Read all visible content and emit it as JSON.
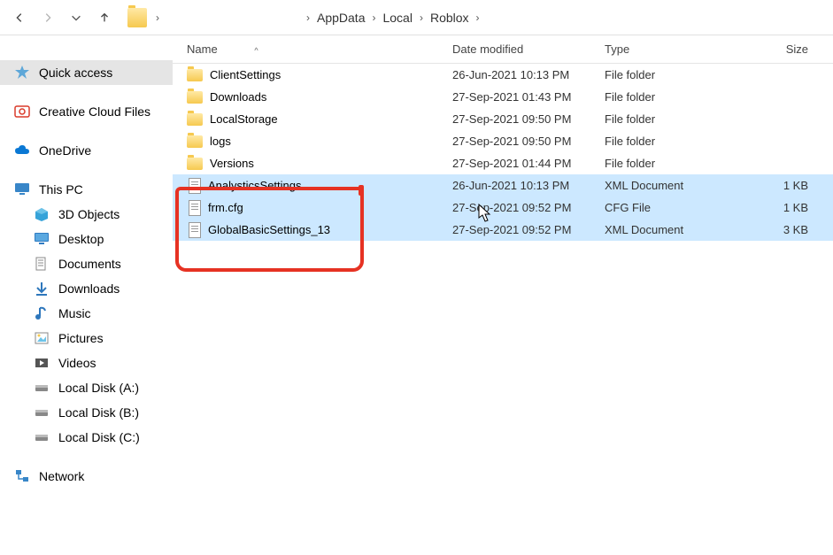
{
  "breadcrumbs": [
    "AppData",
    "Local",
    "Roblox"
  ],
  "sidebar": {
    "quick_access": "Quick access",
    "creative_cloud": "Creative Cloud Files",
    "onedrive": "OneDrive",
    "this_pc": "This PC",
    "objects3d": "3D Objects",
    "desktop": "Desktop",
    "documents": "Documents",
    "downloads": "Downloads",
    "music": "Music",
    "pictures": "Pictures",
    "videos": "Videos",
    "diskA": "Local Disk (A:)",
    "diskB": "Local Disk (B:)",
    "diskC": "Local Disk (C:)",
    "network": "Network"
  },
  "columns": {
    "name": "Name",
    "date": "Date modified",
    "type": "Type",
    "size": "Size"
  },
  "files": [
    {
      "name": "ClientSettings",
      "date": "26-Jun-2021 10:13 PM",
      "type": "File folder",
      "size": "",
      "kind": "folder",
      "selected": false
    },
    {
      "name": "Downloads",
      "date": "27-Sep-2021 01:43 PM",
      "type": "File folder",
      "size": "",
      "kind": "folder",
      "selected": false
    },
    {
      "name": "LocalStorage",
      "date": "27-Sep-2021 09:50 PM",
      "type": "File folder",
      "size": "",
      "kind": "folder",
      "selected": false
    },
    {
      "name": "logs",
      "date": "27-Sep-2021 09:50 PM",
      "type": "File folder",
      "size": "",
      "kind": "folder",
      "selected": false
    },
    {
      "name": "Versions",
      "date": "27-Sep-2021 01:44 PM",
      "type": "File folder",
      "size": "",
      "kind": "folder",
      "selected": false
    },
    {
      "name": "AnalysticsSettings",
      "date": "26-Jun-2021 10:13 PM",
      "type": "XML Document",
      "size": "1 KB",
      "kind": "file",
      "selected": true
    },
    {
      "name": "frm.cfg",
      "date": "27-Sep-2021 09:52 PM",
      "type": "CFG File",
      "size": "1 KB",
      "kind": "file",
      "selected": true
    },
    {
      "name": "GlobalBasicSettings_13",
      "date": "27-Sep-2021 09:52 PM",
      "type": "XML Document",
      "size": "3 KB",
      "kind": "file",
      "selected": true
    }
  ]
}
